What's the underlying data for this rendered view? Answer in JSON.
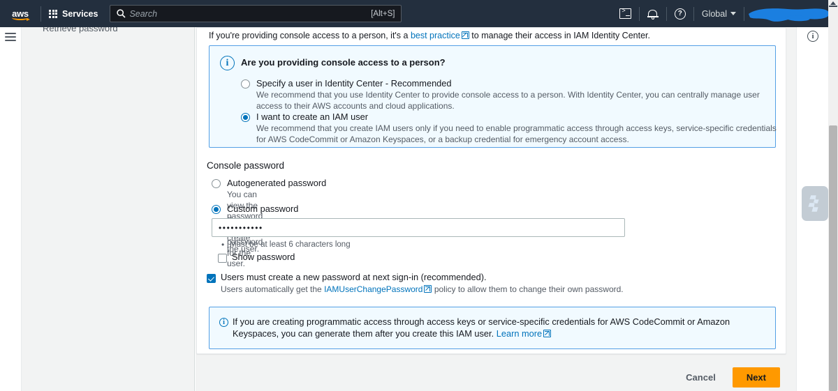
{
  "topnav": {
    "logo_alt": "aws",
    "services_label": "Services",
    "search_placeholder": "Search",
    "search_value": "",
    "search_shortcut": "[Alt+S]",
    "cloudshell_icon": "cloudshell-icon",
    "notifications_icon": "bell-icon",
    "help_icon": "help-circle-icon",
    "region_label": "Global",
    "account_label": ""
  },
  "sidebar": {
    "cut_off_item": "Retrieve password"
  },
  "main": {
    "intro": {
      "prefix": "If you're providing console access to a person, it's a ",
      "link": "best practice",
      "suffix": " to manage their access in IAM Identity Center."
    },
    "console_access_alert": {
      "icon": "info-icon",
      "title": "Are you providing console access to a person?",
      "options": [
        {
          "label": "Specify a user in Identity Center - Recommended",
          "description": "We recommend that you use Identity Center to provide console access to a person. With Identity Center, you can centrally manage user access to their AWS accounts and cloud applications.",
          "selected": false
        },
        {
          "label": "I want to create an IAM user",
          "description": "We recommend that you create IAM users only if you need to enable programmatic access through access keys, service-specific credentials for AWS CodeCommit or Amazon Keyspaces, or a backup credential for emergency account access.",
          "selected": true
        }
      ]
    },
    "console_password": {
      "section_title": "Console password",
      "options": [
        {
          "label": "Autogenerated password",
          "description": "You can view the password after you create the user.",
          "selected": false
        },
        {
          "label": "Custom password",
          "description": "Enter a custom password for the user.",
          "selected": true
        }
      ],
      "password_value": "•••••••••••",
      "password_requirement": "Must be at least 6 characters long",
      "show_password_label": "Show password",
      "show_password_checked": false
    },
    "must_change_password": {
      "label": "Users must create a new password at next sign-in (recommended).",
      "checked": true,
      "sub_prefix": "Users automatically get the ",
      "sub_link": "IAMUserChangePassword",
      "sub_suffix": " policy to allow them to change their own password."
    },
    "programmatic_alert": {
      "icon": "info-icon",
      "text": "If you are creating programmatic access through access keys or service-specific credentials for AWS CodeCommit or Amazon Keyspaces, you can generate them after you create this IAM user. ",
      "link": "Learn more"
    },
    "footer": {
      "cancel_label": "Cancel",
      "next_label": "Next"
    }
  },
  "right_panel": {
    "info_icon": "info-circle-icon",
    "assistant_icon": "amazon-q-flyout-icon"
  },
  "colors": {
    "nav_bg": "#232f3e",
    "accent_orange": "#ff9900",
    "link_blue": "#0073bb",
    "alert_border": "#539fe5",
    "alert_bg": "#f1faff",
    "page_bg": "#f2f3f3",
    "redaction_blue": "#1b7fe0"
  }
}
